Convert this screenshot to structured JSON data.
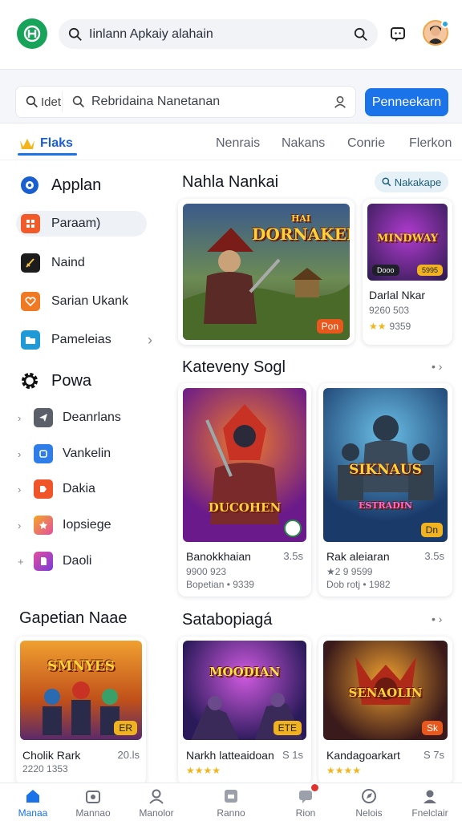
{
  "header": {
    "search_text": "Iinlann Apkaiy alahain"
  },
  "search_strip": {
    "scope_label": "Idet",
    "input_text": "Rebridaina Nanetanan",
    "button_label": "Penneekarn"
  },
  "tabs": [
    {
      "label": "Flaks"
    },
    {
      "label": "Nenrais"
    },
    {
      "label": "Nakans"
    },
    {
      "label": "Conrie"
    },
    {
      "label": "Flerkon"
    }
  ],
  "sidebar": {
    "heading1": "Applan",
    "items": [
      {
        "label": "Paraam)",
        "color": "#f25a2a"
      },
      {
        "label": "Naind",
        "color": "#1c1c1c"
      },
      {
        "label": "Sarian Ukank",
        "color": "#f07a24"
      },
      {
        "label": "Pameleias",
        "color": "#1f9ad6"
      }
    ],
    "heading2": "Powa",
    "subitems": [
      {
        "label": "Deanrlans",
        "color": "#5a5f6a"
      },
      {
        "label": "Vankelin",
        "color": "#2f7de8"
      },
      {
        "label": "Dakia",
        "color": "#f0552a"
      },
      {
        "label": "Iopsiege",
        "color": "#e24fa0"
      },
      {
        "label": "Daoli",
        "color": "#7a3ad8"
      }
    ],
    "heading3": "Gapetian Naae"
  },
  "main": {
    "section1": {
      "title": "Nahla Nankai",
      "chip_label": "Nakakape",
      "card_big": {
        "art_text": "DORNAKEI",
        "art_sub": "HAI",
        "badge": "Pon"
      },
      "card_small": {
        "art_text": "MINDWAY",
        "title": "Darlal Nkar",
        "meta1": "9260 503",
        "meta2": "9359",
        "badges": [
          "Dooo",
          "5995"
        ]
      }
    },
    "section2": {
      "title": "Kateveny Sogl",
      "more": "•",
      "cards": [
        {
          "art_text": "DUCOHEN",
          "title": "Banokkhaian",
          "right": "3.5s",
          "meta1": "9900 923",
          "meta2": "Bopetian • 9339"
        },
        {
          "art_text": "SIKNAUS",
          "art_sub": "ESTRADIN",
          "badge": "Dn",
          "title": "Rak aleiaran",
          "right": "3.5s",
          "meta1": "★2 9 9599",
          "meta2": "Dob rotj • 1982"
        }
      ]
    },
    "section3": {
      "title": "Satabopiagá",
      "more": "•",
      "cards": [
        {
          "art_text": "SMNYES",
          "badge": "ER",
          "title": "Cholik Rark",
          "right": "20.ls",
          "meta1": "2220 1353"
        },
        {
          "art_text": "MOODIAN",
          "badge": "ETE",
          "title": "Narkh latteaidoan",
          "right": "S 1s"
        },
        {
          "art_text": "SENAOLIN",
          "badge": "Sk",
          "title": "Kandagoarkart",
          "right": "S 7s"
        }
      ]
    }
  },
  "bottom_nav": [
    {
      "label": "Manaa",
      "icon": "home-icon",
      "active": true
    },
    {
      "label": "Mannao",
      "icon": "store-icon"
    },
    {
      "label": "Manolor",
      "icon": "person-icon"
    },
    {
      "label": "Ranno",
      "icon": "apps-icon"
    },
    {
      "label": "Rion",
      "icon": "chat-icon"
    },
    {
      "label": "Nelois",
      "icon": "compass-icon"
    },
    {
      "label": "Fnelclair",
      "icon": "account-icon"
    }
  ],
  "colors": {
    "accent": "#1a73e8",
    "brand": "#17a35a"
  }
}
